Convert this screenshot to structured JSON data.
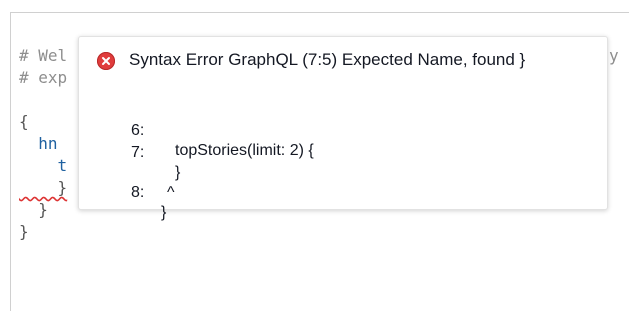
{
  "editor": {
    "lines": [
      {
        "text": "# Wel",
        "tail": "y I"
      },
      {
        "text": "# exp"
      },
      {
        "text": ""
      },
      {
        "text": "{"
      },
      {
        "text": "  hn"
      },
      {
        "text": "    t"
      },
      {
        "text": "    }"
      },
      {
        "text": "  }"
      },
      {
        "text": "}"
      }
    ]
  },
  "tooltip": {
    "icon": "error-circle-icon",
    "title": "Syntax Error GraphQL (7:5) Expected Name, found }",
    "snippet": [
      {
        "line_no": "6:",
        "code": "topStories(limit: 2) {"
      },
      {
        "line_no": "7:",
        "code": "}"
      },
      {
        "line_no": "",
        "code": "^"
      },
      {
        "line_no": "8:",
        "code": "}"
      }
    ]
  },
  "colors": {
    "error_red": "#e03c3c",
    "field_blue": "#1f61a0",
    "comment_gray": "#8e8e8e"
  }
}
